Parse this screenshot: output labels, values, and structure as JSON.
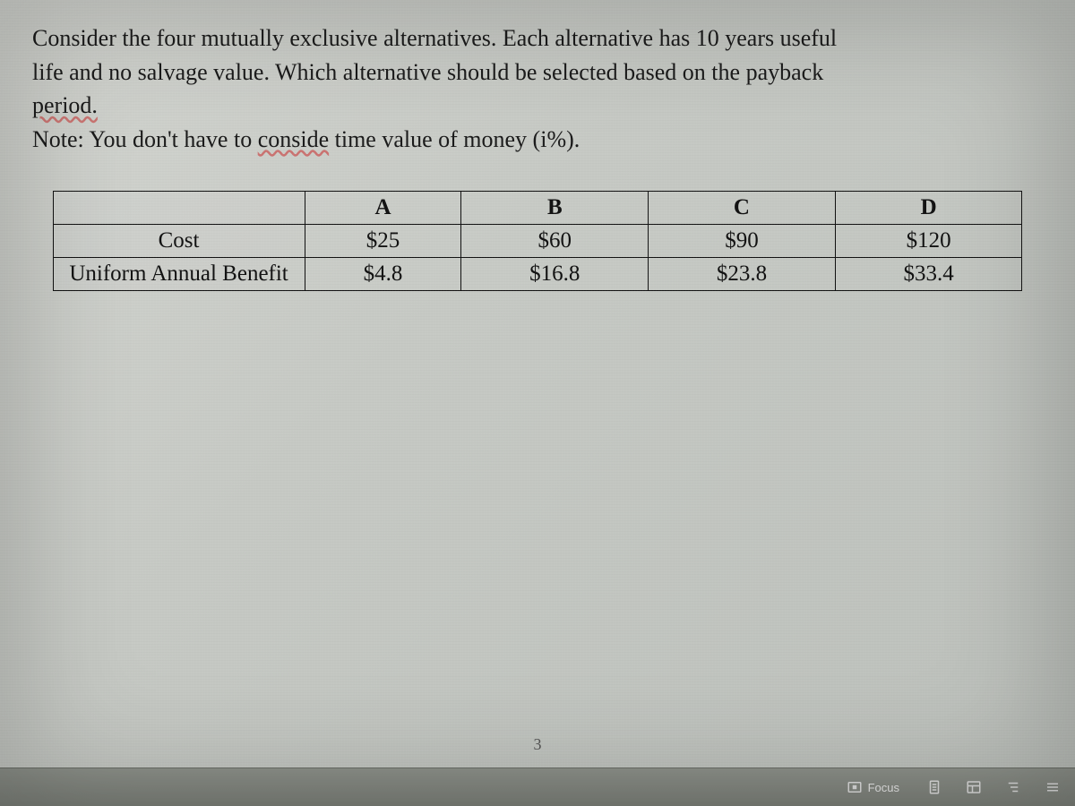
{
  "prompt": {
    "line1": "Consider the four mutually exclusive alternatives. Each alternative has 10 years useful",
    "line2a": "life and no salvage value. Which alternative should be selected based on the payback",
    "underlined1": "period.",
    "note_prefix": "Note: ",
    "note_body_a": "You don't have to ",
    "underlined2": "conside",
    "note_body_b": " time value of money (i%)."
  },
  "chart_data": {
    "type": "table",
    "title": "",
    "columns": [
      "",
      "A",
      "B",
      "C",
      "D"
    ],
    "rows": [
      {
        "label": "Cost",
        "values": [
          "$25",
          "$60",
          "$90",
          "$120"
        ]
      },
      {
        "label": "Uniform Annual Benefit",
        "values": [
          "$4.8",
          "$16.8",
          "$23.8",
          "$33.4"
        ]
      }
    ]
  },
  "page_number": "3",
  "statusbar": {
    "focus_label": "Focus"
  }
}
